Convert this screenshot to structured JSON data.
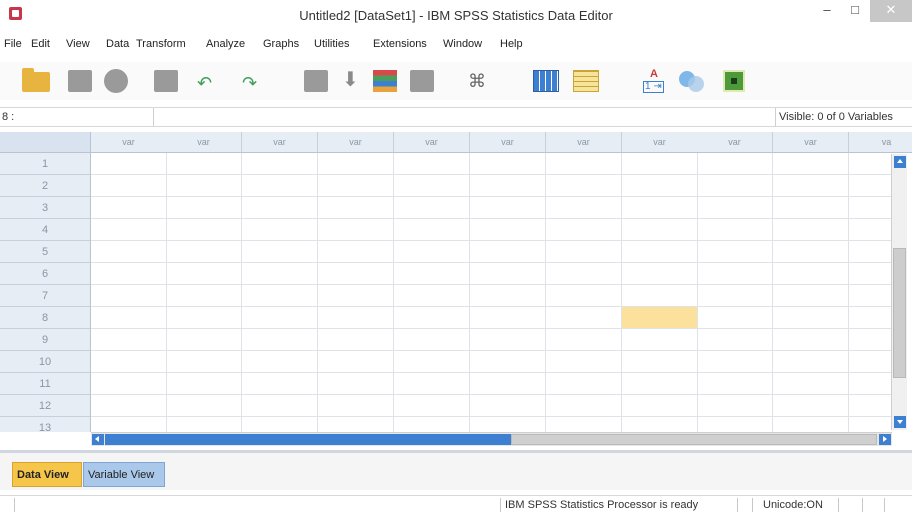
{
  "window": {
    "title": "Untitled2 [DataSet1] - IBM SPSS Statistics Data Editor",
    "minimize": "–",
    "maximize": "□",
    "close": "✕"
  },
  "menu": [
    "File",
    "Edit",
    "View",
    "Data",
    "Transform",
    "Analyze",
    "Graphs",
    "Utilities",
    "Extensions",
    "Window",
    "Help"
  ],
  "toolbar": {
    "icons": [
      "open-icon",
      "save-icon",
      "print-icon",
      "dialog-recall-icon",
      "undo-icon",
      "redo-icon",
      "goto-case-icon",
      "goto-variable-icon",
      "variables-icon",
      "run-descriptives-icon",
      "find-icon",
      "insert-cases-icon",
      "insert-variable-icon",
      "split-file-icon",
      "select-cases-icon",
      "value-labels-icon"
    ]
  },
  "cell_editor": {
    "reference": "8 :",
    "value": "",
    "visible_label": "Visible: 0 of 0 Variables"
  },
  "grid": {
    "columns": [
      "var",
      "var",
      "var",
      "var",
      "var",
      "var",
      "var",
      "var",
      "var",
      "var",
      "va"
    ],
    "rows": [
      "1",
      "2",
      "3",
      "4",
      "5",
      "6",
      "7",
      "8",
      "9",
      "10",
      "11",
      "12",
      "13"
    ],
    "selected_row": "8",
    "selected_column_index": 7,
    "selection_color": "#fbe19c"
  },
  "tabs": {
    "data_view": "Data View",
    "variable_view": "Variable View",
    "active": "Data View"
  },
  "status": {
    "processor": "IBM SPSS Statistics Processor is ready",
    "unicode": "Unicode:ON"
  }
}
